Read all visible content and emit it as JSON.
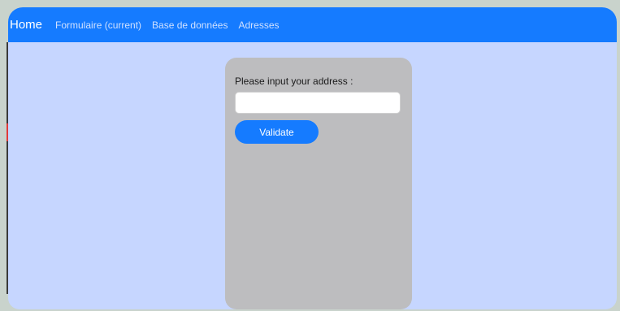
{
  "navbar": {
    "brand": "Home",
    "links": [
      {
        "label": "Formulaire (current)"
      },
      {
        "label": "Base de données"
      },
      {
        "label": "Adresses"
      }
    ]
  },
  "form": {
    "label": "Please input your address :",
    "input_value": "",
    "input_placeholder": "",
    "submit_label": "Validate"
  },
  "colors": {
    "navbar": "#157bff",
    "page_background": "#c6d6ff",
    "card_background": "#bdbdbf",
    "button": "#157bff"
  }
}
